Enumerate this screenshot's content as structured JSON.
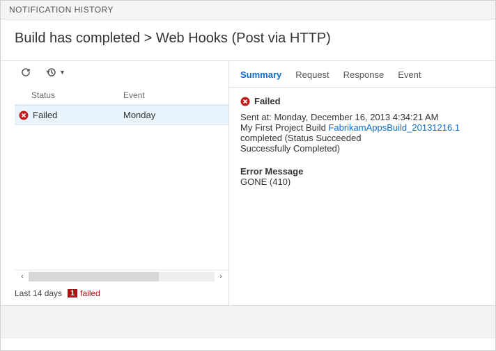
{
  "header": {
    "title": "NOTIFICATION HISTORY"
  },
  "breadcrumb": {
    "event": "Build has completed",
    "sep": ">",
    "consumer": "Web Hooks (Post via HTTP)"
  },
  "toolbar": {
    "refresh_icon": "refresh",
    "history_icon": "history"
  },
  "table": {
    "columns": {
      "status": "Status",
      "event": "Event"
    },
    "rows": [
      {
        "status": "Failed",
        "event": "Monday"
      }
    ]
  },
  "left_footer": {
    "range": "Last 14 days",
    "count": "1",
    "count_label": "failed"
  },
  "tabs": {
    "summary": "Summary",
    "request": "Request",
    "response": "Response",
    "event": "Event",
    "active": "summary"
  },
  "detail": {
    "status_label": "Failed",
    "sent_prefix": "Sent at:",
    "sent_value": "Monday, December 16, 2013 4:34:21 AM",
    "line2_pre": "My First Project Build",
    "line2_link": "FabrikamAppsBuild_20131216.1",
    "line2_post_a": "completed (Status Succeeded",
    "line2_post_b": "Successfully Completed)",
    "error_head": "Error Message",
    "error_body": "GONE (410)"
  },
  "colors": {
    "accent": "#0b6dcf",
    "error": "#c31c1c"
  }
}
